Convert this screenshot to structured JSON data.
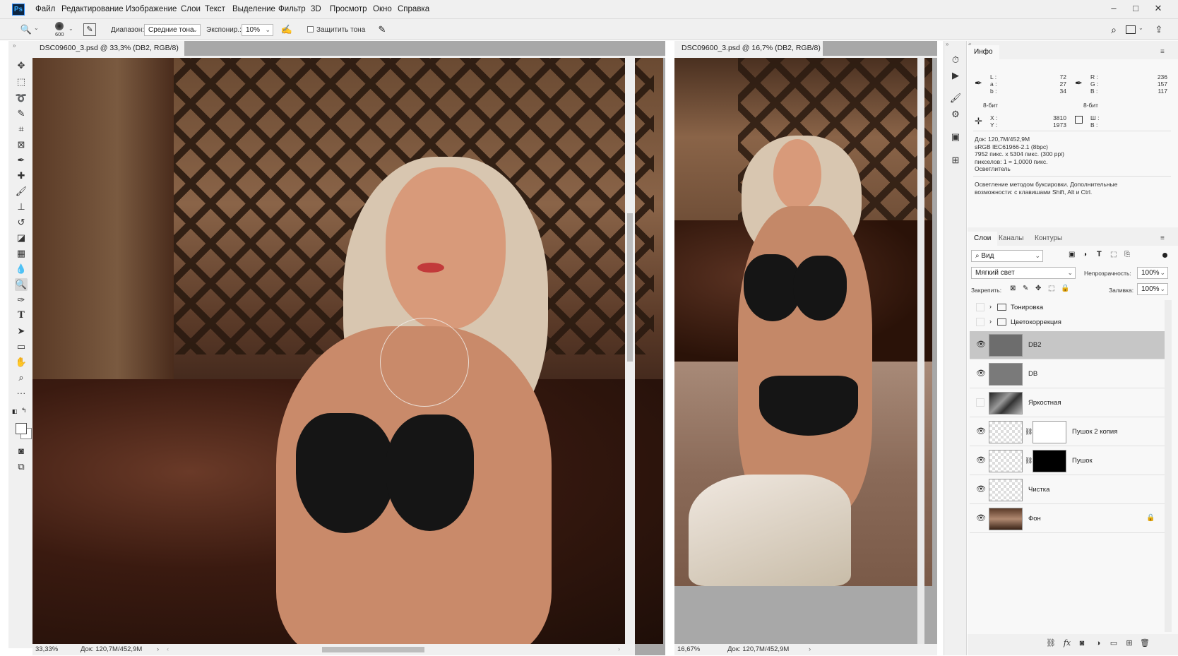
{
  "app": {
    "logo": "Ps"
  },
  "menu": [
    "Файл",
    "Редактирование",
    "Изображение",
    "Слои",
    "Текст",
    "Выделение",
    "Фильтр",
    "3D",
    "Просмотр",
    "Окно",
    "Справка"
  ],
  "window_controls": {
    "minimize": "–",
    "maximize": "□",
    "close": "✕"
  },
  "options": {
    "brush_size": "600",
    "range_label": "Диапазон:",
    "range_value": "Средние тона",
    "exposure_label": "Экспонир.:",
    "exposure_value": "10%",
    "protect_tones_label": "Защитить тона",
    "protect_tones_checked": false
  },
  "tools": [
    "move-tool",
    "marquee-tool",
    "lasso-tool",
    "quick-selection-tool",
    "crop-tool",
    "frame-tool",
    "eyedropper-tool",
    "healing-brush-tool",
    "brush-tool",
    "clone-stamp-tool",
    "history-brush-tool",
    "eraser-tool",
    "gradient-tool",
    "blur-tool",
    "dodge-tool",
    "pen-tool",
    "type-tool",
    "path-selection-tool",
    "rectangle-tool",
    "hand-tool",
    "zoom-tool",
    "more-tools"
  ],
  "documents": [
    {
      "tab": "DSC09600_3.psd @ 33,3% (DB2, RGB/8) *",
      "close": "×",
      "zoom": "33,33%",
      "doc_size": "Док: 120,7M/452,9M"
    },
    {
      "tab": "DSC09600_3.psd @ 16,7% (DB2, RGB/8) *",
      "close": "×",
      "zoom": "16,67%",
      "doc_size": "Док: 120,7M/452,9M"
    }
  ],
  "info_panel": {
    "title": "Инфо",
    "lab": {
      "labels": [
        "L :",
        "a :",
        "b :"
      ],
      "values": [
        "72",
        "27",
        "34"
      ]
    },
    "rgb": {
      "labels": [
        "R :",
        "G :",
        "B :"
      ],
      "values": [
        "236",
        "157",
        "117"
      ]
    },
    "bit_left": "8-бит",
    "bit_right": "8-бит",
    "xy": {
      "labels": [
        "X :",
        "Y :"
      ],
      "values": [
        "3810",
        "1973"
      ]
    },
    "wh": {
      "labels": [
        "Ш :",
        "В :"
      ]
    },
    "doc_lines": [
      "Док: 120,7M/452,9M",
      "sRGB IEC61966-2.1 (8bpc)",
      "7952 пикс. x 5304 пикс. (300 ppi)",
      "пикселов: 1 = 1,0000 пикс.",
      "Осветлитель"
    ],
    "hint": "Осветление методом буксировки.  Дополнительные возможности: с клавишами Shift, Alt и Ctrl."
  },
  "layers_panel": {
    "tabs": [
      "Слои",
      "Каналы",
      "Контуры"
    ],
    "filter_label": "Вид",
    "blend_mode": "Мягкий свет",
    "opacity_label": "Непрозрачность:",
    "opacity_value": "100%",
    "lock_label": "Закрепить:",
    "fill_label": "Заливка:",
    "fill_value": "100%",
    "groups": [
      {
        "name": "Тонировка",
        "visible": false
      },
      {
        "name": "Цветокоррекция",
        "visible": false
      }
    ],
    "layers": [
      {
        "name": "DB2",
        "visible": true,
        "selected": true,
        "thumb": "gray"
      },
      {
        "name": "DB",
        "visible": true,
        "selected": false,
        "thumb": "gray"
      },
      {
        "name": "Яркостная",
        "visible": false,
        "selected": false,
        "thumb": "photo-bw"
      },
      {
        "name": "Пушок 2 копия",
        "visible": true,
        "selected": false,
        "thumb": "transparent",
        "mask": "white"
      },
      {
        "name": "Пушок",
        "visible": true,
        "selected": false,
        "thumb": "transparent",
        "mask": "black"
      },
      {
        "name": "Чистка",
        "visible": true,
        "selected": false,
        "thumb": "transparent"
      },
      {
        "name": "Фон",
        "visible": true,
        "selected": false,
        "thumb": "photo",
        "locked": true
      }
    ]
  }
}
